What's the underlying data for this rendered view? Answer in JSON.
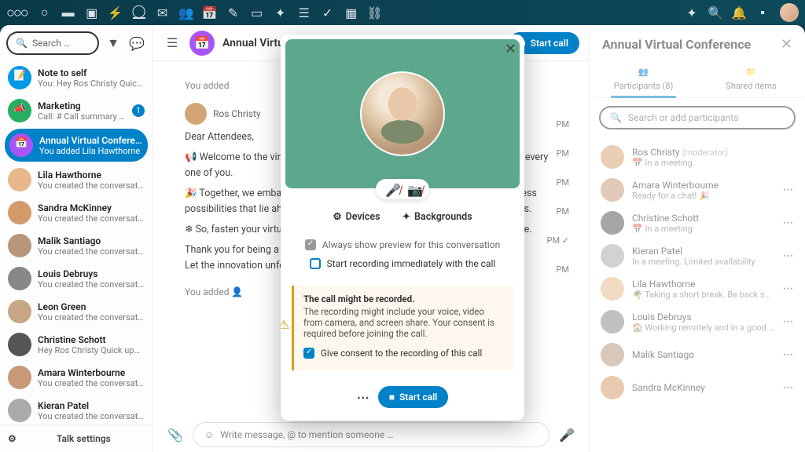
{
  "search_placeholder": "Search …",
  "room": "Annual Virtual Conference",
  "settings_label": "Talk settings",
  "header_title": "Annual Virtual Con",
  "start_call": "Start call",
  "conversations": [
    {
      "name": "Note to self",
      "sub": "You: Hey Ros Christy Quick u…",
      "color": "#0099e5",
      "icon": "📝"
    },
    {
      "name": "Marketing",
      "sub": "Call: # Call summary - …",
      "color": "#27ae60",
      "badge": "1",
      "icon": "📣"
    },
    {
      "name": "Annual Virtual Conference",
      "sub": "You added Lila Hawthorne",
      "color": "#a855f7",
      "active": true,
      "icon": "📅"
    },
    {
      "name": "Lila Hawthorne",
      "sub": "You created the conversation",
      "color": "#e8b88a"
    },
    {
      "name": "Sandra McKinney",
      "sub": "You created the conversation",
      "color": "#d49a6a"
    },
    {
      "name": "Malik Santiago",
      "sub": "You created the conversation",
      "color": "#b8967a"
    },
    {
      "name": "Louis Debruys",
      "sub": "You created the conversation",
      "color": "#888"
    },
    {
      "name": "Leon Green",
      "sub": "You created the conversation",
      "color": "#c8a585"
    },
    {
      "name": "Christine Schott",
      "sub": "Hey Ros Christy Quick updat…",
      "color": "#555"
    },
    {
      "name": "Amara Winterbourne",
      "sub": "You created the conversation",
      "color": "#c89878"
    },
    {
      "name": "Kieran Patel",
      "sub": "You created the conversation",
      "color": "#aaa"
    }
  ],
  "sys1": "You added",
  "sys2": "You added 👤",
  "msg_author": "Ros Christy",
  "msg_greeting": "Dear Attendees,",
  "msg_p1": "📢 Welcome to the virtual conference — lorem ipsum dolor sit amet, each and every one of you.",
  "msg_p2": "🎉 Together, we embark on a journey of discovery and collaboration, the limitless possibilities that lie ahead — whether a seasoned or passionate newcomer, this.",
  "msg_p3": "❄ So, fasten your virtual seatbelts and get ready to connect, learn, and innovate.",
  "msg_p4": "Thank you for being a part of this.\nLet the innovation unfold.",
  "compose_placeholder": "Write message, @ to mention someone …",
  "side_title": "Annual Virtual Conference",
  "tab_participants": "Participants (8)",
  "tab_shared": "Shared items",
  "part_search": "Search or add participants",
  "participants": [
    {
      "name": "Ros Christy",
      "mod": "(moderator)",
      "status": "📅 In a meeting",
      "color": "#d4a574"
    },
    {
      "name": "Amara Winterbourne",
      "status": "Ready for a chat! 🎉",
      "color": "#c89878",
      "more": true
    },
    {
      "name": "Christine Schott",
      "status": "📅 In a meeting",
      "color": "#555",
      "more": true
    },
    {
      "name": "Kieran Patel",
      "status": "In a meeting. Limited availability",
      "color": "#aaa",
      "more": true
    },
    {
      "name": "Lila Hawthorne",
      "status": "🌴 Taking a short break. Be back soon!",
      "color": "#e8b88a",
      "more": true
    },
    {
      "name": "Louis Debruys",
      "status": "🏠 Working remotely and in a good mood! …",
      "color": "#888",
      "more": true
    },
    {
      "name": "Malik Santiago",
      "status": "",
      "color": "#b8967a",
      "more": true
    },
    {
      "name": "Sandra McKinney",
      "status": "",
      "color": "#d49a6a",
      "more": true
    }
  ],
  "modal": {
    "devices": "Devices",
    "backgrounds": "Backgrounds",
    "always_preview": "Always show preview for this conversation",
    "start_recording": "Start recording immediately with the call",
    "warn_title": "The call might be recorded.",
    "warn_body": "The recording might include your voice, video from camera, and screen share. Your consent is required before joining the call.",
    "consent": "Give consent to the recording of this call",
    "start": "Start call"
  },
  "times": [
    "PM",
    "PM",
    "PM",
    "PM",
    "PM ✓",
    "PM"
  ]
}
